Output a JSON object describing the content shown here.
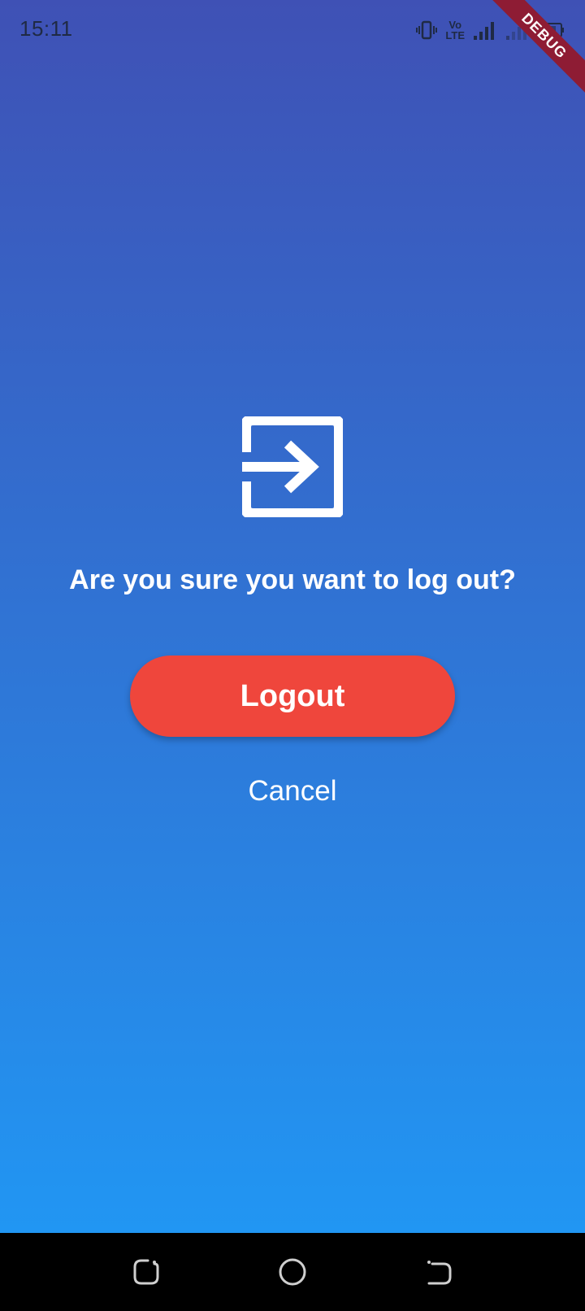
{
  "status_bar": {
    "time": "15:11",
    "icons": [
      "vibrate-icon",
      "volte-icon",
      "signal-icon",
      "signal-weak-icon",
      "battery-icon"
    ],
    "volte_text_top": "Vo",
    "volte_text_bottom": "LTE"
  },
  "debug_banner": {
    "label": "DEBUG",
    "color": "#8e1c34"
  },
  "dialog": {
    "icon": "logout-icon",
    "question": "Are you sure you want to log out?",
    "logout_label": "Logout",
    "cancel_label": "Cancel"
  },
  "colors": {
    "gradient_top": "#3f51b5",
    "gradient_bottom": "#2196f3",
    "logout_button": "#ef463c",
    "text": "#ffffff"
  },
  "nav_bar": {
    "buttons": [
      "recents-icon",
      "home-icon",
      "back-icon"
    ]
  }
}
